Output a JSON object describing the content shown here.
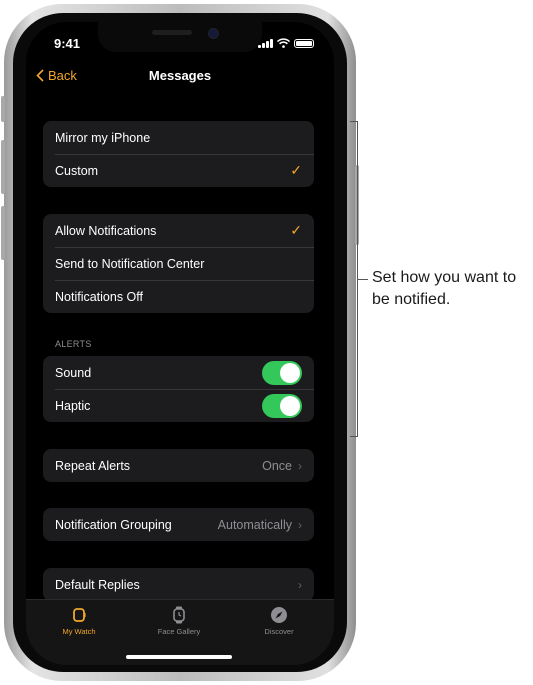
{
  "status_bar": {
    "time": "9:41"
  },
  "nav": {
    "back_label": "Back",
    "title": "Messages"
  },
  "mirror_group": {
    "items": [
      {
        "label": "Mirror my iPhone",
        "checked": false
      },
      {
        "label": "Custom",
        "checked": true
      }
    ]
  },
  "notification_group": {
    "items": [
      {
        "label": "Allow Notifications",
        "checked": true
      },
      {
        "label": "Send to Notification Center",
        "checked": false
      },
      {
        "label": "Notifications Off",
        "checked": false
      }
    ]
  },
  "alerts": {
    "header": "ALERTS",
    "items": [
      {
        "label": "Sound",
        "on": true
      },
      {
        "label": "Haptic",
        "on": true
      }
    ]
  },
  "repeat_alerts": {
    "label": "Repeat Alerts",
    "value": "Once"
  },
  "notification_grouping": {
    "label": "Notification Grouping",
    "value": "Automatically"
  },
  "default_replies": {
    "label": "Default Replies"
  },
  "tabs": [
    {
      "label": "My Watch",
      "icon": "watch-icon",
      "active": true
    },
    {
      "label": "Face Gallery",
      "icon": "watch-face-icon",
      "active": false
    },
    {
      "label": "Discover",
      "icon": "compass-icon",
      "active": false
    }
  ],
  "callout": {
    "text": "Set how you want to be notified."
  },
  "colors": {
    "accent": "#f2a628",
    "toggle_on": "#34c759",
    "cell_bg": "#1c1c1e",
    "screen_bg": "#000000"
  }
}
